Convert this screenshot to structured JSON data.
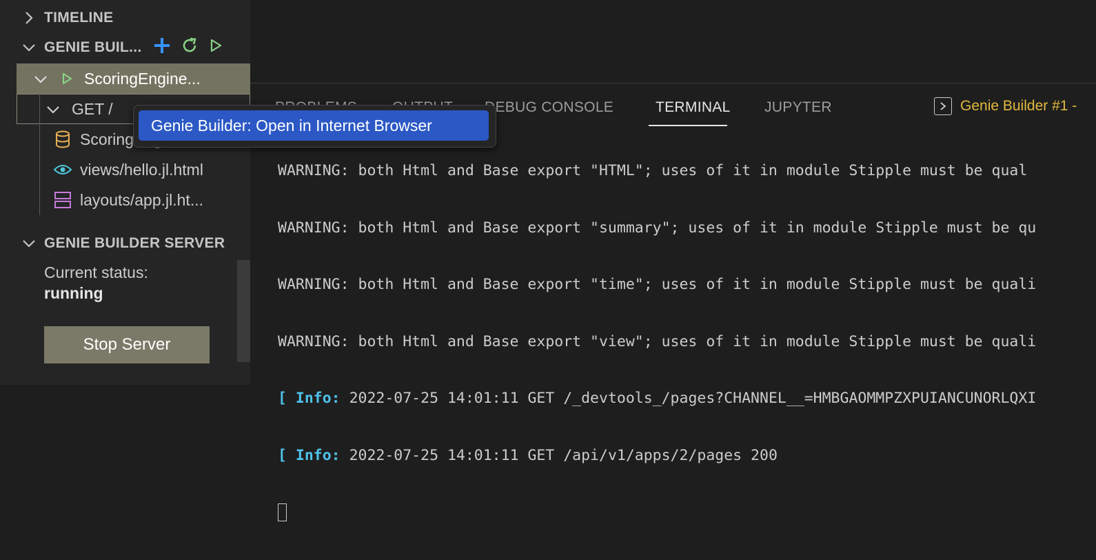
{
  "sidebar": {
    "timeline_section": {
      "title": "TIMELINE"
    },
    "genie_builder_section": {
      "title": "GENIE BUIL...",
      "actions": [
        {
          "icon": "plus-icon",
          "color": "#3794ff"
        },
        {
          "icon": "refresh-icon",
          "color": "#89d185"
        },
        {
          "icon": "play-icon",
          "color": "#89d185"
        }
      ],
      "tree": {
        "app": {
          "label": "ScoringEngine...",
          "icon": "play-icon"
        },
        "route": {
          "label": "GET /"
        },
        "files": [
          {
            "label": "ScoringEngine",
            "icon": "database-icon",
            "color": "#e8b14f"
          },
          {
            "label": "views/hello.jl.html",
            "icon": "eye-icon",
            "color": "#4dc6d6"
          },
          {
            "label": "layouts/app.jl.ht...",
            "icon": "layout-icon",
            "color": "#c77bdb"
          }
        ]
      }
    },
    "server_section": {
      "title": "GENIE BUILDER SERVER",
      "status_label": "Current status:",
      "status_value": "running",
      "stop_button": "Stop Server"
    }
  },
  "panel": {
    "tabs": [
      {
        "label": "PROBLEMS",
        "active": false
      },
      {
        "label": "OUTPUT",
        "active": false
      },
      {
        "label": "DEBUG CONSOLE",
        "active": false
      },
      {
        "label": "TERMINAL",
        "active": true
      },
      {
        "label": "JUPYTER",
        "active": false
      }
    ],
    "terminal_selector": "Genie Builder #1 -",
    "terminal_lines": [
      {
        "type": "text",
        "text": "WARNING: both Html and Base export \"HTML\"; uses of it in module Stipple must be qual"
      },
      {
        "type": "text",
        "text": "WARNING: both Html and Base export \"summary\"; uses of it in module Stipple must be qu"
      },
      {
        "type": "text",
        "text": "WARNING: both Html and Base export \"time\"; uses of it in module Stipple must be quali"
      },
      {
        "type": "text",
        "text": "WARNING: both Html and Base export \"view\"; uses of it in module Stipple must be quali"
      },
      {
        "type": "info",
        "prefix": "[ ",
        "tag": "Info:",
        "text": " 2022-07-25 14:01:11 GET /_devtools_/pages?CHANNEL__=HMBGAOMMPZXPUIANCUNORLQXI"
      },
      {
        "type": "info",
        "prefix": "[ ",
        "tag": "Info:",
        "text": " 2022-07-25 14:01:11 GET /api/v1/apps/2/pages 200"
      }
    ]
  },
  "context_menu": {
    "items": [
      {
        "label": "Genie Builder: Open in Internet Browser"
      }
    ]
  },
  "colors": {
    "selection": "#747361",
    "button": "#7b7a68",
    "menu_highlight": "#2b58c5",
    "info": "#4fc1e9",
    "terminal_title": "#e2b93d"
  }
}
